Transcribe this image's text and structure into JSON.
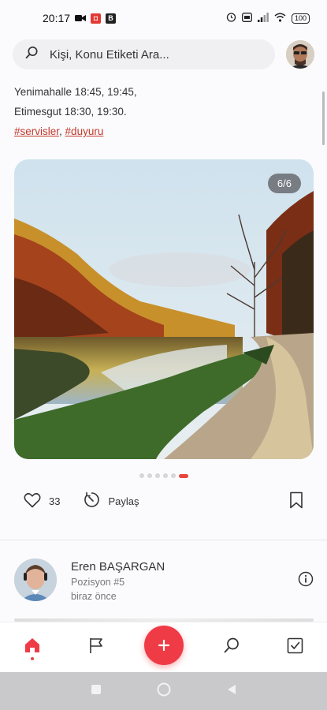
{
  "status_bar": {
    "time": "20:17",
    "battery": "100"
  },
  "search": {
    "placeholder": "Kişi, Konu Etiketi Ara..."
  },
  "post": {
    "lines": [
      "Yenimahalle 18:45, 19:45,",
      "Etimesgut 18:30, 19:30."
    ],
    "tags": [
      "#servisler",
      "#duyuru"
    ],
    "tag_separator": ", ",
    "image_counter": "6/6",
    "slide_count": 6,
    "active_slide": 6,
    "likes": "33",
    "share_label": "Paylaş"
  },
  "next_post": {
    "author_name": "Eren BAŞARGAN",
    "position": "Pozisyon #5",
    "time": "biraz önce"
  },
  "colors": {
    "accent": "#ef3b46",
    "tag": "#c0392b"
  },
  "bottom_nav": [
    "home-icon",
    "flag-icon",
    "add-icon",
    "search-icon",
    "checkbox-icon"
  ]
}
